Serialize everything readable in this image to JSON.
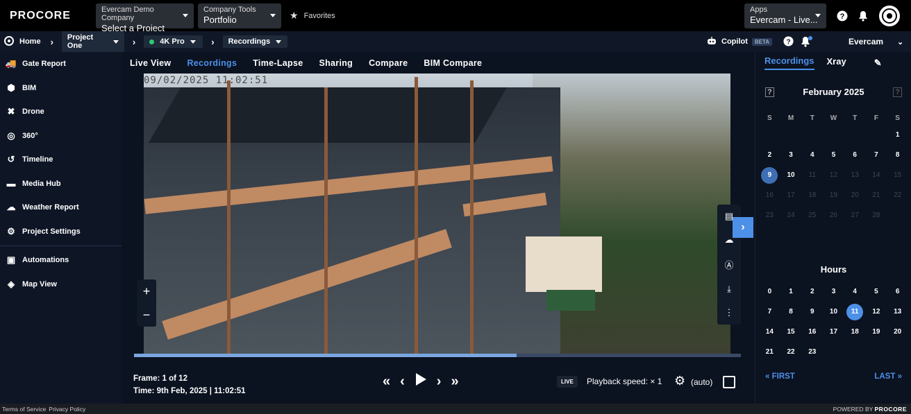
{
  "topbar": {
    "logo": "PROCORE",
    "company": {
      "label": "Evercam Demo Company",
      "value": "Select a Project"
    },
    "tools": {
      "label": "Company Tools",
      "value": "Portfolio"
    },
    "favorites": "Favorites",
    "apps": {
      "label": "Apps",
      "value": "Evercam - Live..."
    }
  },
  "subbar": {
    "home": "Home",
    "project": "Project One",
    "camera": "4K Pro",
    "section": "Recordings",
    "copilot": "Copilot",
    "beta": "BETA",
    "account": "Evercam"
  },
  "sidebar": {
    "items": [
      {
        "label": "Gate Report"
      },
      {
        "label": "BIM"
      },
      {
        "label": "Drone"
      },
      {
        "label": "360°"
      },
      {
        "label": "Timeline"
      },
      {
        "label": "Media Hub"
      },
      {
        "label": "Weather Report"
      },
      {
        "label": "Project Settings"
      },
      {
        "label": "Automations"
      },
      {
        "label": "Map View"
      }
    ]
  },
  "tabs": [
    "Live View",
    "Recordings",
    "Time-Lapse",
    "Sharing",
    "Compare",
    "BIM Compare"
  ],
  "viewer": {
    "timestamp": "09/02/2025 11:02:51",
    "zoom_in": "+",
    "zoom_out": "−",
    "progress_fraction": 0.63
  },
  "controls": {
    "frame": "Frame: 1 of 12",
    "time": "Time: 9th Feb, 2025 | 11:02:51",
    "live": "LIVE",
    "speed": "Playback speed: × 1",
    "quality": "(auto)"
  },
  "rpanel": {
    "tabs": [
      "Recordings",
      "Xray"
    ],
    "month": "February 2025",
    "dow": [
      "S",
      "M",
      "T",
      "W",
      "T",
      "F",
      "S"
    ],
    "hours_title": "Hours",
    "first": "FIRST",
    "last": "LAST"
  },
  "footer": {
    "terms": "Terms of Service",
    "privacy": "Privacy Policy",
    "powered": "POWERED BY",
    "brand": "PROCORE"
  },
  "colors": {
    "accent": "#4d90e8",
    "selected_day": "#3e6fb4",
    "live_dot": "#2ecc71"
  }
}
